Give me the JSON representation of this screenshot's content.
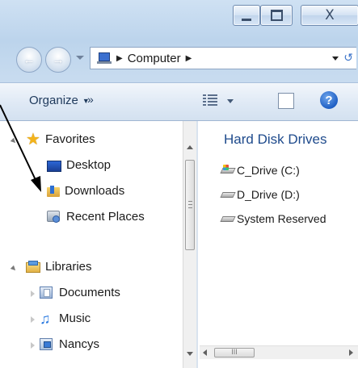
{
  "titlebar": {
    "minimize_icon": "minimize-icon",
    "maximize_icon": "maximize-icon",
    "close_label": "X"
  },
  "address": {
    "location": "Computer",
    "back_icon": "back-arrow-icon",
    "forward_icon": "forward-arrow-icon"
  },
  "toolbar": {
    "organize_label": "Organize",
    "more_label": "»",
    "help_label": "?"
  },
  "nav": {
    "favorites": {
      "label": "Favorites",
      "items": [
        {
          "label": "Desktop",
          "icon": "desktop-icon"
        },
        {
          "label": "Downloads",
          "icon": "downloads-folder-icon"
        },
        {
          "label": "Recent Places",
          "icon": "recent-places-icon"
        }
      ]
    },
    "libraries": {
      "label": "Libraries",
      "items": [
        {
          "label": "Documents",
          "icon": "documents-library-icon"
        },
        {
          "label": "Music",
          "icon": "music-icon"
        },
        {
          "label": "Nancys",
          "icon": "nancys-library-icon"
        }
      ]
    }
  },
  "content": {
    "section_title": "Hard Disk Drives",
    "drives": [
      {
        "label": "C_Drive (C:)",
        "icon": "windows-drive-icon"
      },
      {
        "label": "D_Drive (D:)",
        "icon": "hard-drive-icon"
      },
      {
        "label": "System Reserved",
        "icon": "hard-drive-icon"
      }
    ]
  },
  "colors": {
    "section_title": "#1e4a8c",
    "toolbar_text": "#1e395b",
    "arrow": "#000000"
  }
}
